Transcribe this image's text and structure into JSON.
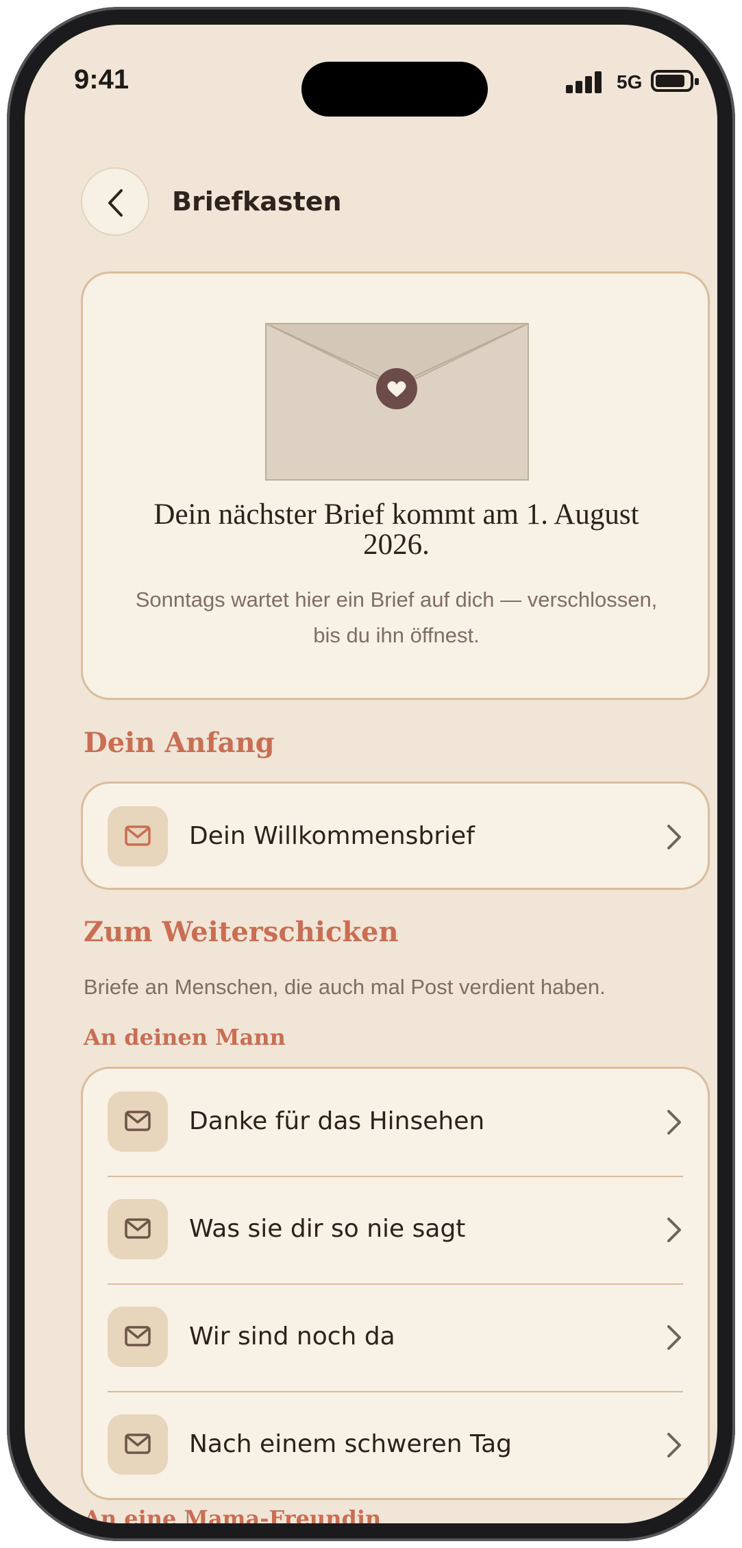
{
  "status_bar": {
    "time": "9:41",
    "network": "5G"
  },
  "header": {
    "title": "Briefkasten"
  },
  "hero": {
    "next_letter": "Dein nächster Brief kommt am 1. August 2026.",
    "hint": "Sonntags wartet hier ein Brief auf dich — verschlossen, bis du ihn öffnest."
  },
  "start_section": {
    "title": "Dein Anfang",
    "items": [
      {
        "label": "Dein Willkommensbrief"
      }
    ]
  },
  "forward_section": {
    "title": "Zum Weiterschicken",
    "description": "Briefe an Menschen, die auch mal Post verdient haben.",
    "groups": [
      {
        "title": "An deinen Mann",
        "items": [
          {
            "label": "Danke für das Hinsehen"
          },
          {
            "label": "Was sie dir so nie sagt"
          },
          {
            "label": "Wir sind noch da"
          },
          {
            "label": "Nach einem schweren Tag"
          }
        ]
      },
      {
        "title": "An eine Mama-Freundin",
        "items": []
      }
    ]
  },
  "colors": {
    "background": "#f0e5d7",
    "card": "#f8f1e5",
    "accent": "#c96e53",
    "seal": "#6d4b48"
  }
}
